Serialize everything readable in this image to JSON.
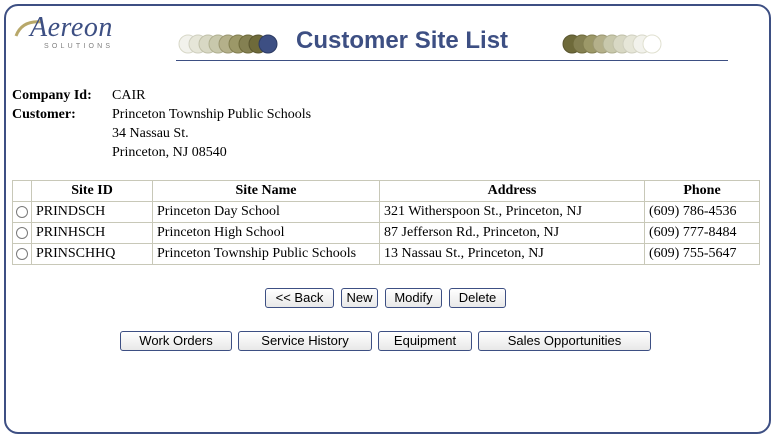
{
  "logo": {
    "name": "Aereon",
    "tagline": "SOLUTIONS"
  },
  "page_title": "Customer Site List",
  "company": {
    "id_label": "Company Id:",
    "id_value": "CAIR",
    "customer_label": "Customer:",
    "customer_name": "Princeton Township Public Schools",
    "address1": "34 Nassau St.",
    "address2": "Princeton, NJ 08540"
  },
  "table": {
    "headers": [
      "Site ID",
      "Site Name",
      "Address",
      "Phone"
    ],
    "rows": [
      {
        "site_id": "PRINDSCH",
        "site_name": "Princeton Day School",
        "address": "321 Witherspoon St., Princeton, NJ",
        "phone": "(609) 786-4536"
      },
      {
        "site_id": "PRINHSCH",
        "site_name": "Princeton High School",
        "address": "87 Jefferson Rd., Princeton, NJ",
        "phone": "(609) 777-8484"
      },
      {
        "site_id": "PRINSCHHQ",
        "site_name": "Princeton Township Public Schools",
        "address": "13 Nassau St., Princeton, NJ",
        "phone": "(609) 755-5647"
      }
    ]
  },
  "actions": {
    "back": "<< Back",
    "new": "New",
    "modify": "Modify",
    "delete": "Delete"
  },
  "links": {
    "work_orders": "Work Orders",
    "service_history": "Service History",
    "equipment": "Equipment",
    "sales_opportunities": "Sales Opportunities"
  },
  "colors": {
    "brand": "#3d4f83",
    "ring_dark": "#6e6a3a",
    "ring_light": "#d8d8c8"
  }
}
